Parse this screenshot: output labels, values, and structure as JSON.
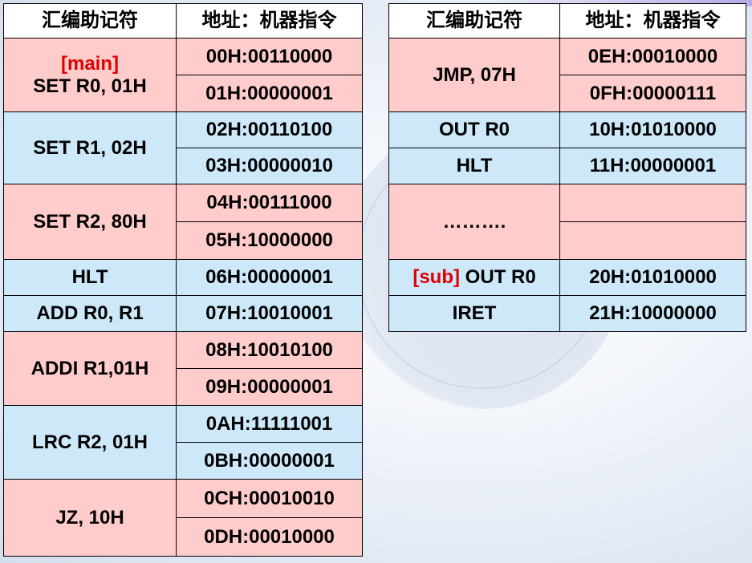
{
  "left_table": {
    "headers": [
      "汇编助记符",
      "地址：机器指令"
    ],
    "groups": [
      {
        "label_prefix": "[main]",
        "mnemonic": "SET R0, 01H",
        "codes": [
          "00H:00110000",
          "01H:00000001"
        ]
      },
      {
        "mnemonic": "SET R1, 02H",
        "codes": [
          "02H:00110100",
          "03H:00000010"
        ]
      },
      {
        "mnemonic": "SET R2, 80H",
        "codes": [
          "04H:00111000",
          "05H:10000000"
        ]
      },
      {
        "mnemonic": "HLT",
        "codes": [
          "06H:00000001"
        ]
      },
      {
        "mnemonic": "ADD R0, R1",
        "codes": [
          "07H:10010001"
        ]
      },
      {
        "mnemonic": "ADDI R1,01H",
        "codes": [
          "08H:10010100",
          "09H:00000001"
        ]
      },
      {
        "mnemonic": "LRC R2, 01H",
        "codes": [
          "0AH:11111001",
          "0BH:00000001"
        ]
      },
      {
        "mnemonic": "JZ, 10H",
        "codes": [
          "0CH:00010010",
          "0DH:00010000"
        ]
      }
    ]
  },
  "right_table": {
    "headers": [
      "汇编助记符",
      "地址：机器指令"
    ],
    "groups": [
      {
        "mnemonic": "JMP, 07H",
        "codes": [
          "0EH:00010000",
          "0FH:00000111"
        ]
      },
      {
        "mnemonic": "OUT R0",
        "codes": [
          "10H:01010000"
        ]
      },
      {
        "mnemonic": "HLT",
        "codes": [
          "11H:00000001"
        ]
      },
      {
        "mnemonic": "……….",
        "codes": [
          "",
          ""
        ]
      },
      {
        "label_prefix": "[sub]",
        "mnemonic": "OUT R0",
        "codes": [
          "20H:01010000"
        ]
      },
      {
        "mnemonic": "IRET",
        "codes": [
          "21H:10000000"
        ]
      }
    ]
  },
  "colors": {
    "pink": "#ffcccc",
    "blue": "#cce8f9",
    "label_red": "#e00000"
  }
}
